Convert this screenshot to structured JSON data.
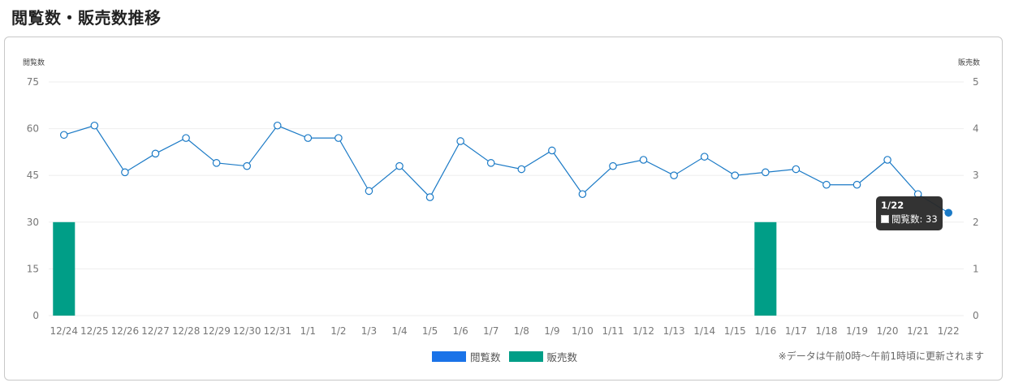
{
  "page": {
    "title": "閲覧数・販売数推移",
    "note": "※データは午前0時〜午前1時頃に更新されます"
  },
  "legend": [
    {
      "label": "閲覧数",
      "color": "#1a73e8"
    },
    {
      "label": "販売数",
      "color": "#009e87"
    }
  ],
  "tooltip": {
    "title": "1/22",
    "label": "閲覧数: 33"
  },
  "colors": {
    "views_line": "#1b7ac6",
    "sales_bar": "#009e87",
    "grid": "#eeeeee",
    "tick_text": "#777777"
  },
  "chart_data": {
    "type": "bar+line",
    "categories": [
      "12/24",
      "12/25",
      "12/26",
      "12/27",
      "12/28",
      "12/29",
      "12/30",
      "12/31",
      "1/1",
      "1/2",
      "1/3",
      "1/4",
      "1/5",
      "1/6",
      "1/7",
      "1/8",
      "1/9",
      "1/10",
      "1/11",
      "1/12",
      "1/13",
      "1/14",
      "1/15",
      "1/16",
      "1/17",
      "1/18",
      "1/19",
      "1/20",
      "1/21",
      "1/22"
    ],
    "series": [
      {
        "name": "閲覧数",
        "type": "line",
        "axis": "left",
        "values": [
          58,
          61,
          46,
          52,
          57,
          49,
          48,
          61,
          57,
          57,
          40,
          48,
          38,
          56,
          49,
          47,
          53,
          39,
          48,
          50,
          45,
          51,
          45,
          46,
          47,
          42,
          42,
          50,
          39,
          33
        ]
      },
      {
        "name": "販売数",
        "type": "bar",
        "axis": "right",
        "values": [
          2,
          0,
          0,
          0,
          0,
          0,
          0,
          0,
          0,
          0,
          0,
          0,
          0,
          0,
          0,
          0,
          0,
          0,
          0,
          0,
          0,
          0,
          0,
          2,
          0,
          0,
          0,
          0,
          0,
          0
        ]
      }
    ],
    "ylabel_left": "閲覧数",
    "ylabel_right": "販売数",
    "ylim_left": [
      0,
      75
    ],
    "yticks_left": [
      "0",
      "15",
      "30",
      "45",
      "60",
      "75"
    ],
    "ylim_right": [
      0,
      5
    ],
    "yticks_right": [
      "0",
      "1",
      "2",
      "3",
      "4",
      "5"
    ],
    "grid": true,
    "legend_position": "bottom"
  }
}
